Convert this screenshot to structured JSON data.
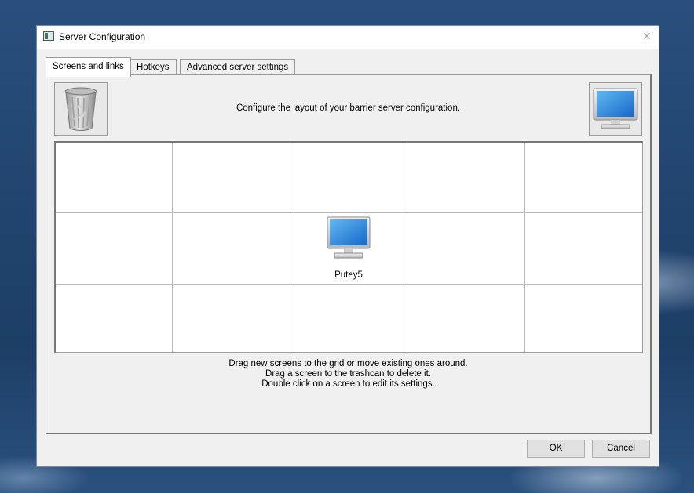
{
  "window": {
    "title": "Server Configuration",
    "close_label": "✕"
  },
  "tabs": [
    {
      "label": "Screens and links",
      "active": true
    },
    {
      "label": "Hotkeys",
      "active": false
    },
    {
      "label": "Advanced server settings",
      "active": false
    }
  ],
  "panel": {
    "intro": "Configure the layout of your barrier server configuration.",
    "grid": {
      "rows": 3,
      "cols": 5,
      "screens": [
        {
          "name": "Putey5",
          "row": 2,
          "col": 3,
          "icon": "monitor-icon"
        }
      ]
    },
    "help_lines": [
      "Drag new screens to the grid or move existing ones around.",
      "Drag a screen to the trashcan to delete it.",
      "Double click on a screen to edit its settings."
    ],
    "icons": {
      "trash": "trashcan-icon",
      "new_screen": "monitor-icon"
    }
  },
  "buttons": {
    "ok": "OK",
    "cancel": "Cancel"
  },
  "colors": {
    "accent": "#1f7fd8",
    "window_bg": "#f0f0f0"
  }
}
